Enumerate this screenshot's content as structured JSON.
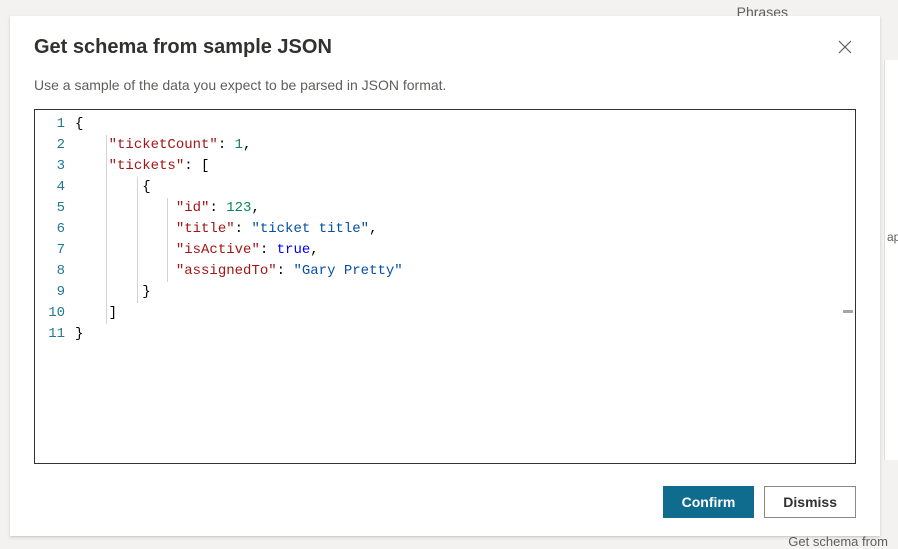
{
  "background": {
    "phrases_label": "Phrases",
    "sidebar_snippet": "ap",
    "getschema_label": "Get schema from"
  },
  "modal": {
    "title": "Get schema from sample JSON",
    "subtitle": "Use a sample of the data you expect to be parsed in JSON format."
  },
  "editor": {
    "line_numbers": [
      "1",
      "2",
      "3",
      "4",
      "5",
      "6",
      "7",
      "8",
      "9",
      "10",
      "11"
    ],
    "json_sample": {
      "ticketCount": 1,
      "tickets": [
        {
          "id": 123,
          "title": "ticket title",
          "isActive": true,
          "assignedTo": "Gary Pretty"
        }
      ]
    },
    "tokens": [
      [
        {
          "t": "brace",
          "v": "{"
        }
      ],
      [
        {
          "t": "pad",
          "v": "    "
        },
        {
          "t": "key",
          "v": "\"ticketCount\""
        },
        {
          "t": "colon",
          "v": ": "
        },
        {
          "t": "num",
          "v": "1"
        },
        {
          "t": "brace",
          "v": ","
        }
      ],
      [
        {
          "t": "pad",
          "v": "    "
        },
        {
          "t": "key",
          "v": "\"tickets\""
        },
        {
          "t": "colon",
          "v": ": "
        },
        {
          "t": "brace",
          "v": "["
        }
      ],
      [
        {
          "t": "pad",
          "v": "        "
        },
        {
          "t": "brace",
          "v": "{"
        }
      ],
      [
        {
          "t": "pad",
          "v": "            "
        },
        {
          "t": "key",
          "v": "\"id\""
        },
        {
          "t": "colon",
          "v": ": "
        },
        {
          "t": "num",
          "v": "123"
        },
        {
          "t": "brace",
          "v": ","
        }
      ],
      [
        {
          "t": "pad",
          "v": "            "
        },
        {
          "t": "key",
          "v": "\"title\""
        },
        {
          "t": "colon",
          "v": ": "
        },
        {
          "t": "str",
          "v": "\"ticket title\""
        },
        {
          "t": "brace",
          "v": ","
        }
      ],
      [
        {
          "t": "pad",
          "v": "            "
        },
        {
          "t": "key",
          "v": "\"isActive\""
        },
        {
          "t": "colon",
          "v": ": "
        },
        {
          "t": "bool",
          "v": "true"
        },
        {
          "t": "brace",
          "v": ","
        }
      ],
      [
        {
          "t": "pad",
          "v": "            "
        },
        {
          "t": "key",
          "v": "\"assignedTo\""
        },
        {
          "t": "colon",
          "v": ": "
        },
        {
          "t": "str",
          "v": "\"Gary Pretty\""
        }
      ],
      [
        {
          "t": "pad",
          "v": "        "
        },
        {
          "t": "brace",
          "v": "}"
        }
      ],
      [
        {
          "t": "pad",
          "v": "    "
        },
        {
          "t": "brace",
          "v": "]"
        }
      ],
      [
        {
          "t": "brace",
          "v": "}"
        }
      ]
    ]
  },
  "footer": {
    "confirm_label": "Confirm",
    "dismiss_label": "Dismiss"
  }
}
